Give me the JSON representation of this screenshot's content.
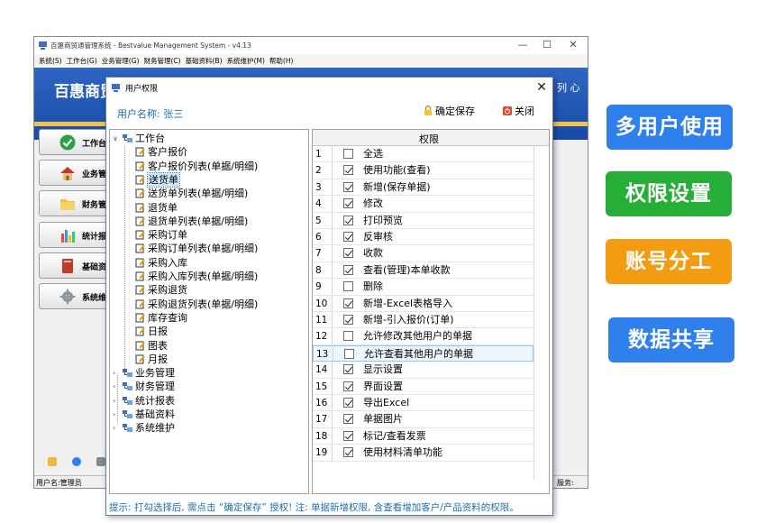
{
  "main_window": {
    "title": "百惠商贸通管理系统 - Bestvalue Management System - v4.13",
    "controls": {
      "minimize": "—",
      "maximize": "☐",
      "close": "✕"
    },
    "menu": [
      "系统(S)",
      "工作台(G)",
      "业务管理(G)",
      "财务管理(C)",
      "基础资料(B)",
      "系统维护(M)",
      "帮助(H)"
    ],
    "banner_title": "百惠商贸",
    "banner_slogan": "列 心",
    "sidebar": [
      {
        "label": "工作台",
        "icon": "checkmark-icon"
      },
      {
        "label": "业务管",
        "icon": "house-icon"
      },
      {
        "label": "财务管",
        "icon": "folder-icon"
      },
      {
        "label": "统计报",
        "icon": "chart-icon"
      },
      {
        "label": "基础资",
        "icon": "book-icon"
      },
      {
        "label": "系统维",
        "icon": "gear-icon"
      }
    ],
    "status_user": "用户名:管理员",
    "status_service": "服务:"
  },
  "dialog": {
    "title": "用户权限",
    "close_glyph": "✕",
    "user_label": "用户名称: 张三",
    "save_label": "确定保存",
    "close_label": "关闭",
    "tree": {
      "root": "工作台",
      "children": [
        "客户报价",
        "客户报价列表(单据/明细)",
        "送货单",
        "送货单列表(单据/明细)",
        "退货单",
        "退货单列表(单据/明细)",
        "采购订单",
        "采购订单列表(单据/明细)",
        "采购入库",
        "采购入库列表(单据/明细)",
        "采购退货",
        "采购退货列表(单据/明细)",
        "库存查询",
        "日报",
        "图表",
        "月报"
      ],
      "selected_index": 2,
      "collapsed": [
        "业务管理",
        "财务管理",
        "统计报表",
        "基础资料",
        "系统维护"
      ]
    },
    "grid": {
      "header": "权限",
      "rows": [
        {
          "num": "1",
          "label": "全选",
          "checked": false
        },
        {
          "num": "2",
          "label": "使用功能(查看)",
          "checked": true
        },
        {
          "num": "3",
          "label": "新增(保存单据)",
          "checked": true
        },
        {
          "num": "4",
          "label": "修改",
          "checked": true
        },
        {
          "num": "5",
          "label": "打印预览",
          "checked": true
        },
        {
          "num": "6",
          "label": "反审核",
          "checked": true
        },
        {
          "num": "7",
          "label": "收款",
          "checked": true
        },
        {
          "num": "8",
          "label": "查看(管理)本单收款",
          "checked": true
        },
        {
          "num": "9",
          "label": "删除",
          "checked": false
        },
        {
          "num": "10",
          "label": "新增-Excel表格导入",
          "checked": true
        },
        {
          "num": "11",
          "label": "新增-引入报价(订单)",
          "checked": true
        },
        {
          "num": "12",
          "label": "允许修改其他用户的单据",
          "checked": false
        },
        {
          "num": "13",
          "label": "允许查看其他用户的单据",
          "checked": false
        },
        {
          "num": "14",
          "label": "显示设置",
          "checked": true
        },
        {
          "num": "15",
          "label": "界面设置",
          "checked": true
        },
        {
          "num": "16",
          "label": "导出Excel",
          "checked": true
        },
        {
          "num": "17",
          "label": "单据图片",
          "checked": true
        },
        {
          "num": "18",
          "label": "标记/查看发票",
          "checked": true
        },
        {
          "num": "19",
          "label": "使用材料清单功能",
          "checked": true
        }
      ],
      "highlighted_row": 12
    },
    "tip": "提示: 打勾选择后, 需点击 “确定保存” 授权!  注: 单据新增权限, 含查看增加客户/产品资料的权限。"
  },
  "badges": [
    {
      "label": "多用户使用",
      "color": "#2f80ed"
    },
    {
      "label": "权限设置",
      "color": "#27ae38"
    },
    {
      "label": "账号分工",
      "color": "#f39c12"
    },
    {
      "label": "数据共享",
      "color": "#2f80ed"
    }
  ],
  "colors": {
    "banner": "#1f55b3",
    "accent_text": "#1a6fb0",
    "selection": "#cce8ff"
  }
}
